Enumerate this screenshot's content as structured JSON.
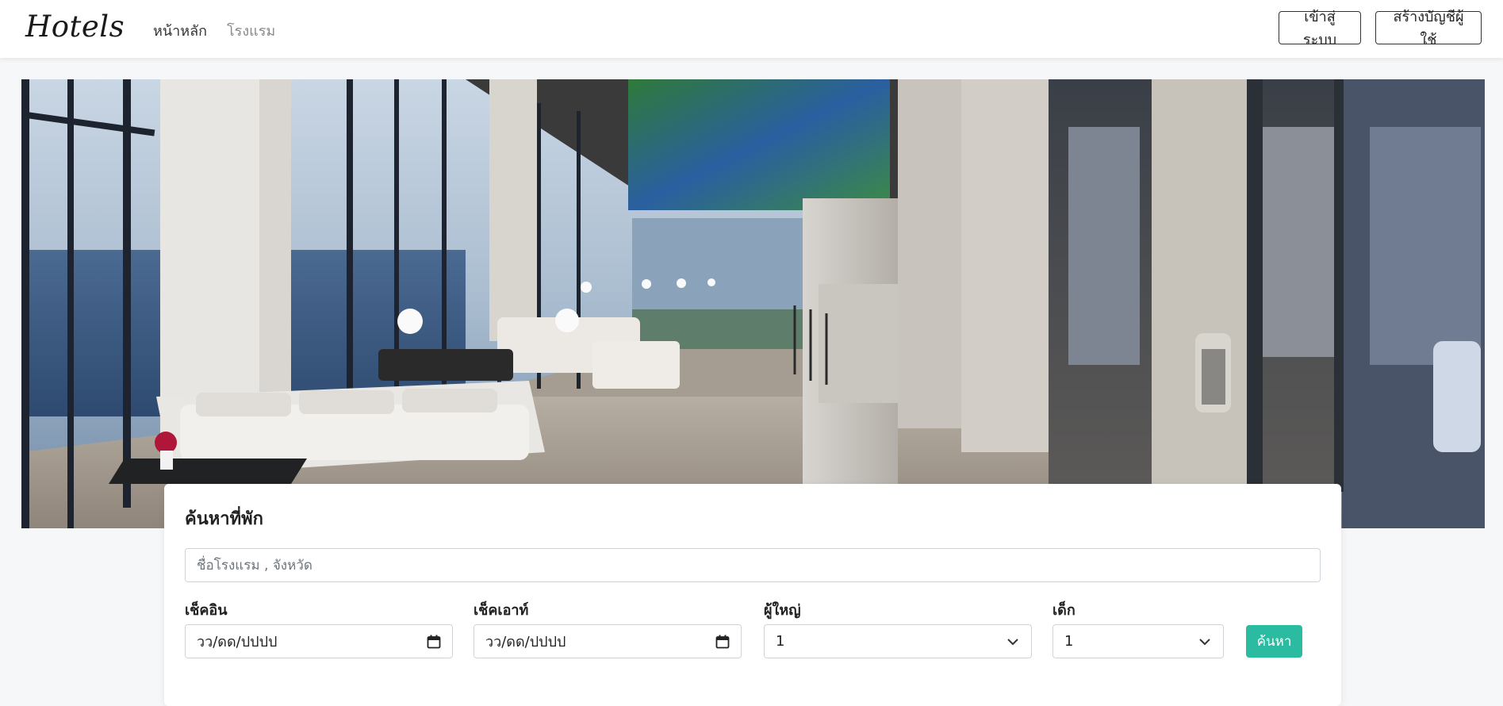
{
  "navbar": {
    "brand": "Hotels",
    "links": [
      {
        "label": "หน้าหลัก"
      },
      {
        "label": "โรงแรม"
      }
    ],
    "login_label": "เข้าสู่ระบบ",
    "register_label": "สร้างบัญชีผู้ใช้"
  },
  "hero": {
    "image": "hotel-lobby-photo"
  },
  "search": {
    "title": "ค้นหาที่พัก",
    "placeholder": "ชื่อโรงแรม , จังหวัด",
    "checkin": {
      "label": "เช็คอิน",
      "value": "วว/ดด/ปปปป",
      "icon": "calendar-icon"
    },
    "checkout": {
      "label": "เช็คเอาท์",
      "value": "วว/ดด/ปปปป",
      "icon": "calendar-icon"
    },
    "adults": {
      "label": "ผู้ใหญ่",
      "value": "1",
      "icon": "chevron-down-icon"
    },
    "kids": {
      "label": "เด็ก",
      "value": "1",
      "icon": "chevron-down-icon"
    },
    "button_label": "ค้นหา"
  },
  "colors": {
    "accent": "#2bbba0",
    "navbar_bg": "#ffffff",
    "page_bg": "#f6f7f9"
  }
}
